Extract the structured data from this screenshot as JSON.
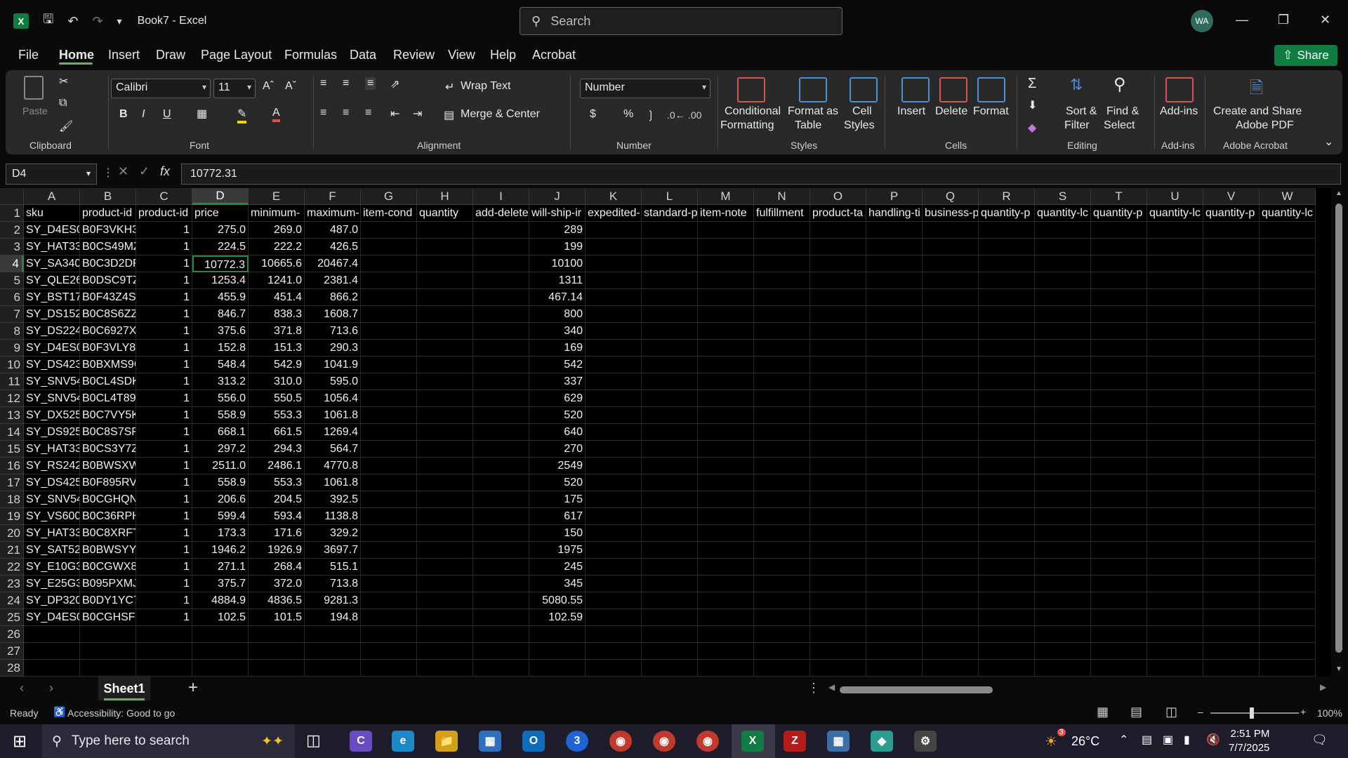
{
  "app": {
    "title": "Book7  -  Excel",
    "search_placeholder": "Search",
    "avatar_initials": "WA"
  },
  "menu": {
    "file": "File",
    "home": "Home",
    "insert": "Insert",
    "draw": "Draw",
    "page_layout": "Page Layout",
    "formulas": "Formulas",
    "data": "Data",
    "review": "Review",
    "view": "View",
    "help": "Help",
    "acrobat": "Acrobat",
    "share": "Share"
  },
  "ribbon": {
    "clipboard": {
      "paste": "Paste",
      "label": "Clipboard"
    },
    "font": {
      "name": "Calibri",
      "size": "11",
      "label": "Font"
    },
    "alignment": {
      "wrap_text": "Wrap Text",
      "merge_center": "Merge & Center",
      "label": "Alignment"
    },
    "number": {
      "format": "Number",
      "label": "Number"
    },
    "styles": {
      "conditional": "Conditional",
      "formatting": "Formatting",
      "format_as": "Format as",
      "table": "Table",
      "cell": "Cell",
      "styles": "Styles",
      "label": "Styles"
    },
    "cells": {
      "insert": "Insert",
      "delete": "Delete",
      "format": "Format",
      "label": "Cells"
    },
    "editing": {
      "sort": "Sort &",
      "filter": "Filter",
      "find": "Find &",
      "select": "Select",
      "label": "Editing"
    },
    "addins": {
      "button": "Add-ins",
      "label": "Add-ins"
    },
    "acrobat": {
      "line1": "Create and Share",
      "line2": "Adobe PDF",
      "label": "Adobe Acrobat"
    }
  },
  "formula_bar": {
    "name_box": "D4",
    "fx": "fx",
    "value": "10772.31"
  },
  "grid": {
    "columns": [
      "A",
      "B",
      "C",
      "D",
      "E",
      "F",
      "G",
      "H",
      "I",
      "J",
      "K",
      "L",
      "M",
      "N",
      "O",
      "P",
      "Q",
      "R",
      "S",
      "T",
      "U",
      "V",
      "W"
    ],
    "headers": [
      "sku",
      "product-id",
      "product-id",
      "price",
      "minimum-",
      "maximum-",
      "item-cond",
      "quantity",
      "add-delete",
      "will-ship-ir",
      "expedited-",
      "standard-p",
      "item-note",
      "fulfillment",
      "product-ta",
      "handling-ti",
      "business-p",
      "quantity-p",
      "quantity-lc",
      "quantity-p",
      "quantity-lc",
      "quantity-p",
      "quantity-lc"
    ],
    "rows": [
      [
        "SY_D4ES0",
        "B0F3VKH3",
        "1",
        "275.0",
        "269.0",
        "487.0",
        "289"
      ],
      [
        "SY_HAT33",
        "B0CS49MZ",
        "1",
        "224.5",
        "222.2",
        "426.5",
        "199"
      ],
      [
        "SY_SA340",
        "B0C3D2DF",
        "1",
        "10772.3",
        "10665.6",
        "20467.4",
        "10100"
      ],
      [
        "SY_QLE26",
        "B0DSC9TZ",
        "1",
        "1253.4",
        "1241.0",
        "2381.4",
        "1311"
      ],
      [
        "SY_BST17",
        "B0F43Z4SE",
        "1",
        "455.9",
        "451.4",
        "866.2",
        "467.14"
      ],
      [
        "SY_DS152",
        "B0C8S6ZZ",
        "1",
        "846.7",
        "838.3",
        "1608.7",
        "800"
      ],
      [
        "SY_DS224",
        "B0C6927X",
        "1",
        "375.6",
        "371.8",
        "713.6",
        "340"
      ],
      [
        "SY_D4ES0",
        "B0F3VLY8",
        "1",
        "152.8",
        "151.3",
        "290.3",
        "169"
      ],
      [
        "SY_DS423",
        "B0BXMS9C",
        "1",
        "548.4",
        "542.9",
        "1041.9",
        "542"
      ],
      [
        "SY_SNV54",
        "B0CL4SDK",
        "1",
        "313.2",
        "310.0",
        "595.0",
        "337"
      ],
      [
        "SY_SNV54",
        "B0CL4T89",
        "1",
        "556.0",
        "550.5",
        "1056.4",
        "629"
      ],
      [
        "SY_DX525",
        "B0C7VY5K",
        "1",
        "558.9",
        "553.3",
        "1061.8",
        "520"
      ],
      [
        "SY_DS925",
        "B0C8S7SF",
        "1",
        "668.1",
        "661.5",
        "1269.4",
        "640"
      ],
      [
        "SY_HAT33",
        "B0CS3Y7Z",
        "1",
        "297.2",
        "294.3",
        "564.7",
        "270"
      ],
      [
        "SY_RS242",
        "B0BWSXW",
        "1",
        "2511.0",
        "2486.1",
        "4770.8",
        "2549"
      ],
      [
        "SY_DS425",
        "B0F895RV",
        "1",
        "558.9",
        "553.3",
        "1061.8",
        "520"
      ],
      [
        "SY_SNV54",
        "B0CGHQN",
        "1",
        "206.6",
        "204.5",
        "392.5",
        "175"
      ],
      [
        "SY_VS600",
        "B0C36RPH",
        "1",
        "599.4",
        "593.4",
        "1138.8",
        "617"
      ],
      [
        "SY_HAT33",
        "B0C8XRFT",
        "1",
        "173.3",
        "171.6",
        "329.2",
        "150"
      ],
      [
        "SY_SAT52",
        "B0BWSYY",
        "1",
        "1946.2",
        "1926.9",
        "3697.7",
        "1975"
      ],
      [
        "SY_E10G3",
        "B0CGWX8",
        "1",
        "271.1",
        "268.4",
        "515.1",
        "245"
      ],
      [
        "SY_E25G3",
        "B095PXMJ",
        "1",
        "375.7",
        "372.0",
        "713.8",
        "345"
      ],
      [
        "SY_DP320",
        "B0DY1YC7",
        "1",
        "4884.9",
        "4836.5",
        "9281.3",
        "5080.55"
      ],
      [
        "SY_D4ES0",
        "B0CGHSF3",
        "1",
        "102.5",
        "101.5",
        "194.8",
        "102.59"
      ]
    ],
    "row_numbers": [
      "1",
      "2",
      "3",
      "4",
      "5",
      "6",
      "7",
      "8",
      "9",
      "10",
      "11",
      "12",
      "13",
      "14",
      "15",
      "16",
      "17",
      "18",
      "19",
      "20",
      "21",
      "22",
      "23",
      "24",
      "25",
      "26",
      "27",
      "28"
    ],
    "selected_cell": "D4"
  },
  "sheets": {
    "active": "Sheet1",
    "add": "+"
  },
  "status": {
    "ready": "Ready",
    "accessibility": "Accessibility: Good to go",
    "zoom": "100%"
  },
  "taskbar": {
    "search_placeholder": "Type here to search",
    "weather": "26°C",
    "time": "2:51 PM",
    "date": "7/7/2025",
    "weather_badge": "3"
  },
  "colors": {
    "accent": "#107c41",
    "select": "#1e8a4e",
    "tab_underline": "#5cb85c"
  }
}
